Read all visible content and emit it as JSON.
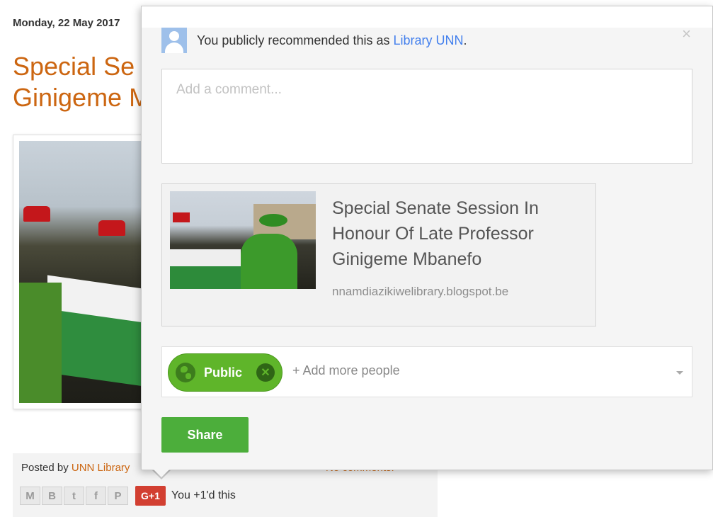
{
  "blog": {
    "post_date": "Monday, 22 May 2017",
    "post_title_line1": "Special Se",
    "post_title_line2": "Ginigeme M",
    "footer": {
      "posted_by_label": "Posted by",
      "author_link": "UNN Library",
      "comments_link": "No comments:",
      "share_buttons": [
        {
          "name": "email-share",
          "glyph": "M"
        },
        {
          "name": "blogger-share",
          "glyph": "B"
        },
        {
          "name": "twitter-share",
          "glyph": "t"
        },
        {
          "name": "facebook-share",
          "glyph": "f"
        },
        {
          "name": "pinterest-share",
          "glyph": "P"
        }
      ],
      "gplus_label": "G+1",
      "plus_one_text": "You +1'd this"
    }
  },
  "dialog": {
    "recommended_prefix": "You publicly recommended this as",
    "recommended_account": "Library UNN",
    "recommended_suffix": ".",
    "close_glyph": "×",
    "comment_placeholder": "Add a comment...",
    "link_card": {
      "title": "Special Senate Session In Honour Of Late Professor Ginigeme Mbanefo",
      "url": "nnamdiazikiwelibrary.blogspot.be"
    },
    "audience_chip": "Public",
    "audience_chip_remove": "✕",
    "add_people_placeholder": "+ Add more people",
    "share_button": "Share"
  },
  "colors": {
    "title_orange": "#cc6611",
    "link_blue": "#427fed",
    "public_green": "#5fb52a",
    "share_green": "#4cae3b",
    "gplus_red": "#d23f31"
  }
}
